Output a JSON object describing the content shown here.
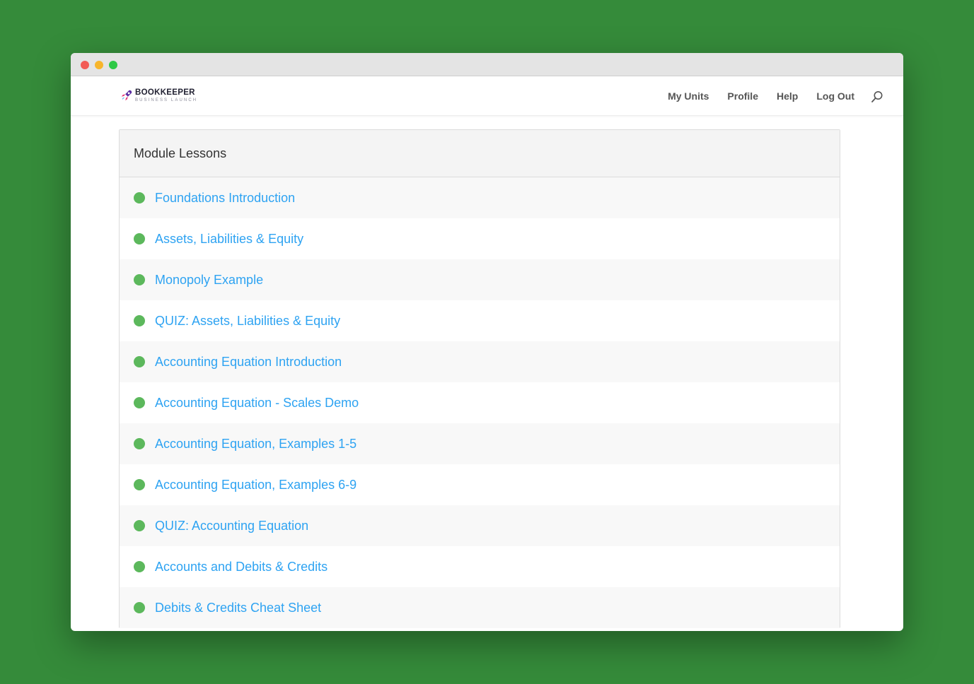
{
  "window": {
    "controls": [
      "close",
      "minimize",
      "maximize"
    ]
  },
  "brand": {
    "name": "BOOKKEEPER",
    "tagline": "BUSINESS LAUNCH"
  },
  "nav": {
    "links": [
      "My Units",
      "Profile",
      "Help",
      "Log Out"
    ],
    "search_icon": "search-icon"
  },
  "module": {
    "title": "Module Lessons",
    "lessons": [
      {
        "title": "Foundations Introduction",
        "completed": true
      },
      {
        "title": "Assets, Liabilities & Equity",
        "completed": true
      },
      {
        "title": "Monopoly Example",
        "completed": true
      },
      {
        "title": "QUIZ: Assets, Liabilities & Equity",
        "completed": true
      },
      {
        "title": "Accounting Equation Introduction",
        "completed": true
      },
      {
        "title": "Accounting Equation - Scales Demo",
        "completed": true
      },
      {
        "title": "Accounting Equation, Examples 1-5",
        "completed": true
      },
      {
        "title": "Accounting Equation, Examples 6-9",
        "completed": true
      },
      {
        "title": "QUIZ: Accounting Equation",
        "completed": true
      },
      {
        "title": "Accounts and Debits & Credits",
        "completed": true
      },
      {
        "title": "Debits & Credits Cheat Sheet",
        "completed": true
      }
    ]
  },
  "colors": {
    "background": "#358b3a",
    "link": "#2ea3f2",
    "completed_dot": "#5cb85c"
  }
}
